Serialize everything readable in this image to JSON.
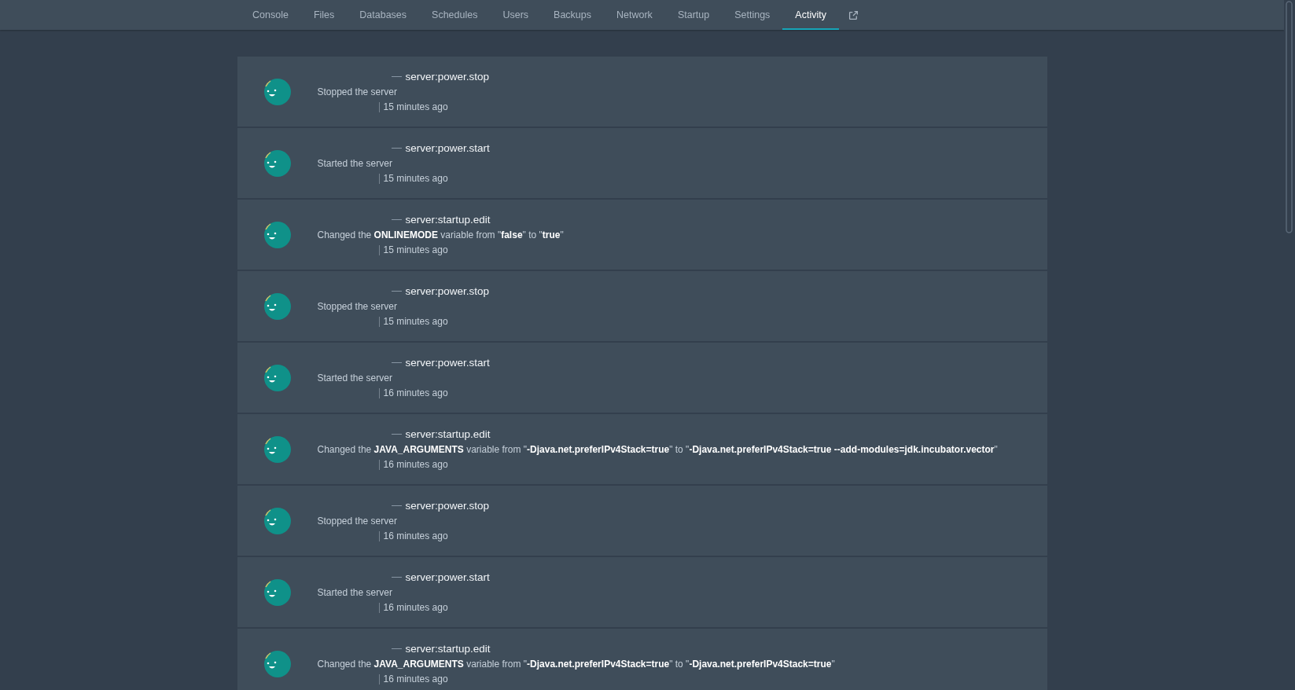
{
  "nav": {
    "tabs": [
      {
        "label": "Console",
        "selected": false
      },
      {
        "label": "Files",
        "selected": false
      },
      {
        "label": "Databases",
        "selected": false
      },
      {
        "label": "Schedules",
        "selected": false
      },
      {
        "label": "Users",
        "selected": false
      },
      {
        "label": "Backups",
        "selected": false
      },
      {
        "label": "Network",
        "selected": false
      },
      {
        "label": "Startup",
        "selected": false
      },
      {
        "label": "Settings",
        "selected": false
      },
      {
        "label": "Activity",
        "selected": true
      }
    ]
  },
  "activity": [
    {
      "event": "server:power.stop",
      "description": "Stopped the server",
      "time": "15 minutes ago"
    },
    {
      "event": "server:power.start",
      "description": "Started the server",
      "time": "15 minutes ago"
    },
    {
      "event": "server:startup.edit",
      "description": "Changed the **ONLINEMODE** variable from \"**false**\" to \"**true**\"",
      "time": "15 minutes ago"
    },
    {
      "event": "server:power.stop",
      "description": "Stopped the server",
      "time": "15 minutes ago"
    },
    {
      "event": "server:power.start",
      "description": "Started the server",
      "time": "16 minutes ago"
    },
    {
      "event": "server:startup.edit",
      "description": "Changed the **JAVA_ARGUMENTS** variable from \"**-Djava.net.preferIPv4Stack=true**\" to \"**-Djava.net.preferIPv4Stack=true --add-modules=jdk.incubator.vector**\"",
      "time": "16 minutes ago"
    },
    {
      "event": "server:power.stop",
      "description": "Stopped the server",
      "time": "16 minutes ago"
    },
    {
      "event": "server:power.start",
      "description": "Started the server",
      "time": "16 minutes ago"
    },
    {
      "event": "server:startup.edit",
      "description": "Changed the **JAVA_ARGUMENTS** variable from \"**-Djava.net.preferIPv4Stack=true**\" to \"**-Djava.net.preferIPv4Stack=true**\"",
      "time": "16 minutes ago"
    }
  ]
}
